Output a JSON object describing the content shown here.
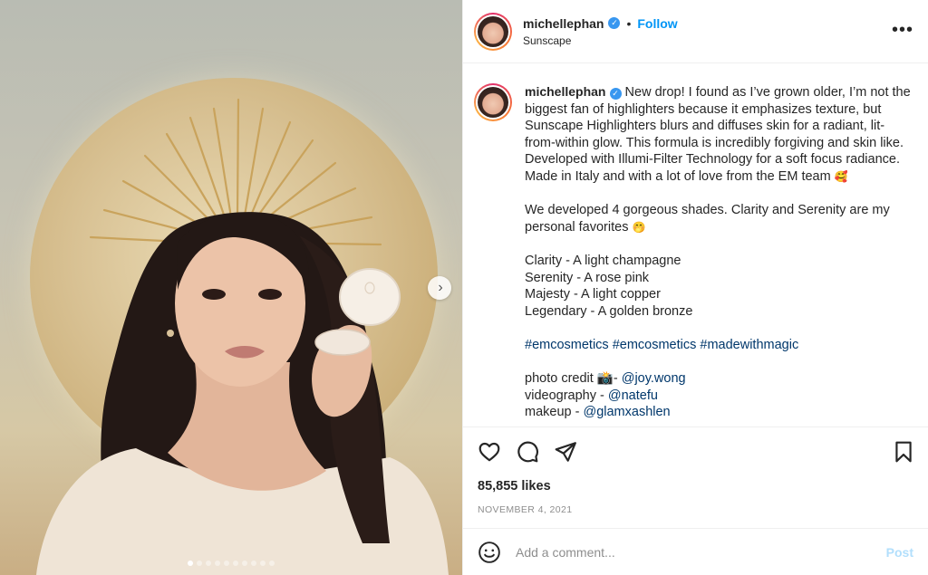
{
  "header": {
    "username": "michellephan",
    "separator": "•",
    "follow_label": "Follow",
    "location": "Sunscape",
    "more_label": "•••"
  },
  "caption": {
    "username": "michellephan",
    "intro": "New drop! I found as I’ve grown older, I’m not the biggest fan of highlighters because it emphasizes texture, but Sunscape Highlighters blurs and diffuses skin for a radiant, lit-from-within glow. This formula is incredibly forgiving and skin like. Developed with Illumi-Filter Technology for a soft focus radiance. Made in Italy and with a lot of love from the EM team",
    "intro_emoji": "🥰",
    "shades_intro": "We developed 4 gorgeous shades. Clarity and Serenity are my personal favorites",
    "shades_emoji": "🤭",
    "shades": [
      "Clarity - A light champagne",
      "Serenity - A rose pink",
      "Majesty - A light copper",
      "Legendary - A golden bronze"
    ],
    "hashtags": [
      "#emcosmetics",
      "#emcosmetics",
      "#madewithmagic"
    ],
    "credits": [
      {
        "label": "photo credit 📸-",
        "handle": "@joy.wong"
      },
      {
        "label": "videography -",
        "handle": "@natefu"
      },
      {
        "label": "makeup -",
        "handle": "@glamxashlen"
      }
    ]
  },
  "likes": "85,855 likes",
  "date": "NOVEMBER 4, 2021",
  "comment": {
    "placeholder": "Add a comment...",
    "post_label": "Post"
  },
  "carousel": {
    "next_label": "›",
    "dot_count": 10,
    "active_dot": 0
  },
  "icons": {
    "verified": "verified-badge-icon",
    "like": "heart-icon",
    "comment": "comment-bubble-icon",
    "share": "paper-plane-icon",
    "save": "bookmark-icon",
    "emoji": "smiley-face-icon",
    "next": "chevron-right-icon"
  },
  "colors": {
    "link_blue": "#0095f6",
    "hashtag": "#00376b",
    "verified": "#3897f0",
    "post_disabled": "#b2dffc",
    "muted": "#8e8e8e"
  }
}
